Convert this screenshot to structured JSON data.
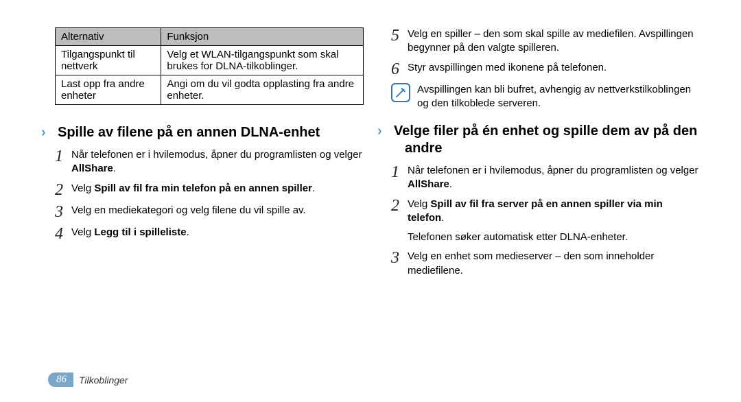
{
  "table": {
    "headers": [
      "Alternativ",
      "Funksjon"
    ],
    "rows": [
      [
        "Tilgangspunkt til nettverk",
        "Velg et WLAN-tilgangspunkt som skal brukes for DLNA-tilkoblinger."
      ],
      [
        "Last opp fra andre enheter",
        "Angi om du vil godta opplasting fra andre enheter."
      ]
    ]
  },
  "left": {
    "title": "Spille av filene på en annen DLNA-enhet",
    "steps": [
      {
        "n": "1",
        "pre": "Når telefonen er i hvilemodus, åpner du programlisten og velger ",
        "bold": "AllShare",
        "post": "."
      },
      {
        "n": "2",
        "pre": "Velg ",
        "bold": "Spill av fil fra min telefon på en annen spiller",
        "post": "."
      },
      {
        "n": "3",
        "pre": "Velg en mediekategori og velg filene du vil spille av.",
        "bold": "",
        "post": ""
      },
      {
        "n": "4",
        "pre": "Velg ",
        "bold": "Legg til i spilleliste",
        "post": "."
      }
    ]
  },
  "right": {
    "steps_top": [
      {
        "n": "5",
        "text": "Velg en spiller – den som skal spille av mediefilen. Avspillingen begynner på den valgte spilleren."
      },
      {
        "n": "6",
        "text": "Styr avspillingen med ikonene på telefonen."
      }
    ],
    "note": "Avspillingen kan bli bufret, avhengig av nettverkstilkoblingen og den tilkoblede serveren.",
    "title": "Velge filer på én enhet og spille dem av på den andre",
    "steps": [
      {
        "n": "1",
        "pre": "Når telefonen er i hvilemodus, åpner du programlisten og velger ",
        "bold": "AllShare",
        "post": "."
      },
      {
        "n": "2",
        "pre": "Velg ",
        "bold": "Spill av fil fra server på en annen spiller via min telefon",
        "post": "."
      }
    ],
    "sub_note": "Telefonen søker automatisk etter DLNA-enheter.",
    "step3": {
      "n": "3",
      "text": "Velg en enhet som medieserver – den som inneholder mediefilene."
    }
  },
  "footer": {
    "page": "86",
    "section": "Tilkoblinger"
  }
}
